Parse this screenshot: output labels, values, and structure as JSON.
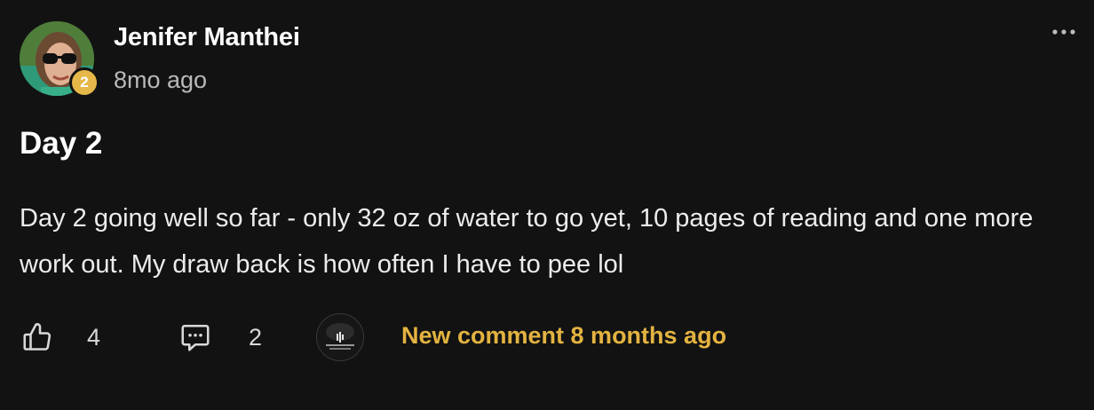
{
  "post": {
    "author": "Jenifer Manthei",
    "level": "2",
    "time": "8mo ago",
    "title": "Day 2",
    "body": "Day 2 going well so far - only 32 oz of water to go yet, 10 pages of reading and one more work out. My draw back is how often I have to pee lol"
  },
  "actions": {
    "like_icon": "thumbs-up-icon",
    "likes": "4",
    "comment_icon": "comment-icon",
    "comments": "2",
    "new_comment_label": "New comment 8 months ago"
  },
  "colors": {
    "background": "#121212",
    "accent": "#e3b341",
    "level_badge": "#e6b84a",
    "text": "#ececec",
    "muted": "#b9b9b9"
  }
}
